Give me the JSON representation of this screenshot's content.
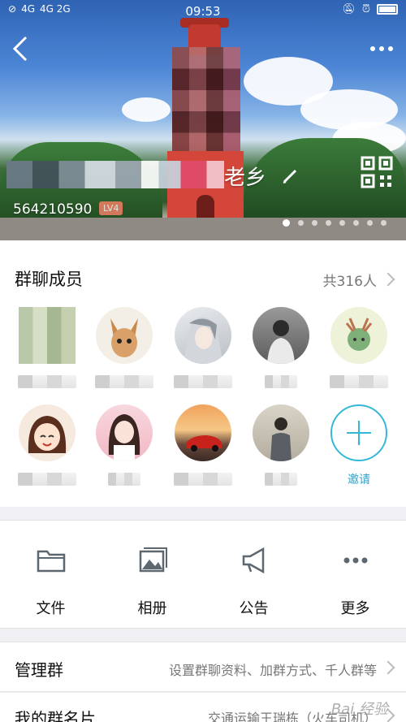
{
  "status_bar": {
    "signal_1": "4G",
    "signal_2": "4G 2G",
    "time": "09:53"
  },
  "header": {
    "group_name": "老乡",
    "group_id": "564210590",
    "level_badge": "LV4",
    "carousel": {
      "count": 8,
      "active": 0
    }
  },
  "members": {
    "title": "群聊成员",
    "count_label": "共316人",
    "invite_label": "邀请"
  },
  "actions": [
    {
      "label": "文件",
      "icon": "folder-icon"
    },
    {
      "label": "相册",
      "icon": "album-icon"
    },
    {
      "label": "公告",
      "icon": "megaphone-icon"
    },
    {
      "label": "更多",
      "icon": "more-horizontal-icon"
    }
  ],
  "manage": {
    "title": "管理群",
    "value": "设置群聊资料、加群方式、千人群等"
  },
  "my_card": {
    "title": "我的群名片",
    "value": "交通运输王瑞栋（火车司机）"
  },
  "watermark": "Bai 经验"
}
